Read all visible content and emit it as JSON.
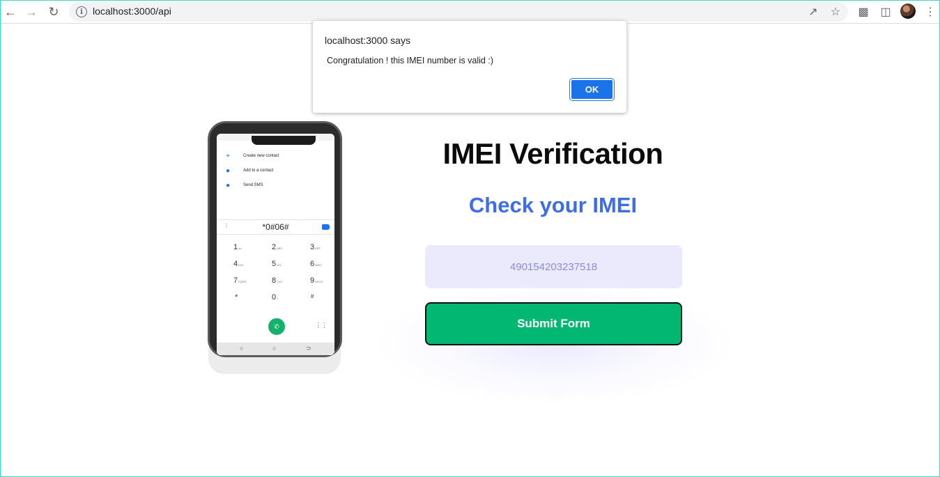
{
  "browser": {
    "url": "localhost:3000/api"
  },
  "dialog": {
    "title": "localhost:3000 says",
    "message": "Congratulation ! this IMEI number is valid :)",
    "ok_label": "OK"
  },
  "phone": {
    "menu_items": [
      {
        "label": "Create new contact",
        "icon": "plus-icon"
      },
      {
        "label": "Add to a contact",
        "icon": "add-person-icon"
      },
      {
        "label": "Send SMS",
        "icon": "message-icon"
      }
    ],
    "dialed_number": "*0#06#",
    "keys": [
      {
        "digit": "1",
        "letters": "oo"
      },
      {
        "digit": "2",
        "letters": "ABC"
      },
      {
        "digit": "3",
        "letters": "DEF"
      },
      {
        "digit": "4",
        "letters": "GHI"
      },
      {
        "digit": "5",
        "letters": "JKL"
      },
      {
        "digit": "6",
        "letters": "MNO"
      },
      {
        "digit": "7",
        "letters": "PQRS"
      },
      {
        "digit": "8",
        "letters": "TUV"
      },
      {
        "digit": "9",
        "letters": "WXYZ"
      },
      {
        "digit": "*",
        "letters": ""
      },
      {
        "digit": "0",
        "letters": "+"
      },
      {
        "digit": "#",
        "letters": ""
      }
    ]
  },
  "main": {
    "heading": "IMEI Verification",
    "subheading": "Check your IMEI",
    "imei_value": "490154203237518",
    "submit_label": "Submit Form"
  },
  "colors": {
    "accent_blue": "#3d6ee8",
    "submit_green": "#02b772",
    "input_bg": "#ebeafc",
    "dialog_button": "#1a73e8"
  }
}
